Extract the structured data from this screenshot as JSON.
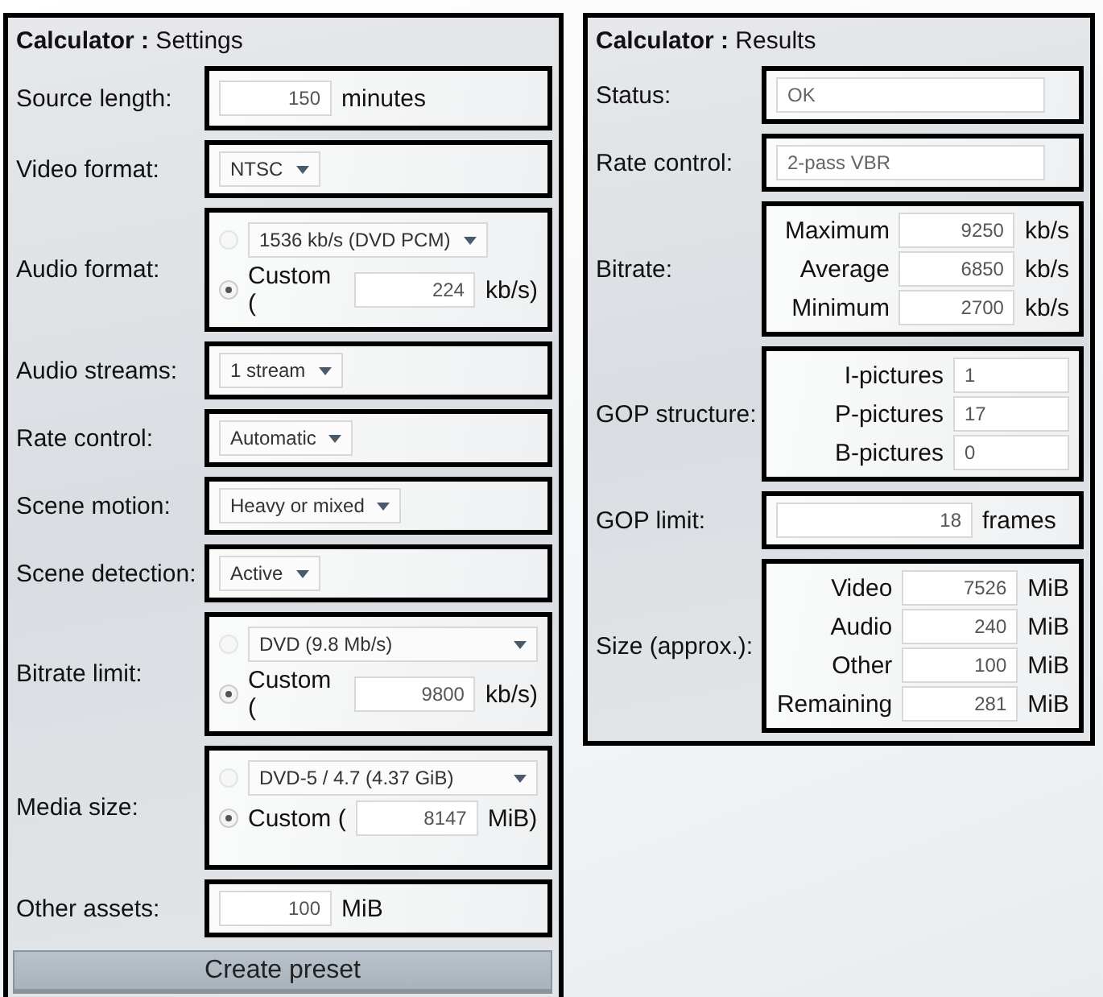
{
  "settings": {
    "title": "**Calculator :** Settings",
    "rows": [
      {
        "kind": "input",
        "label": "Source length:",
        "value": "150",
        "unit": "minutes"
      },
      {
        "kind": "select",
        "label": "Video format:",
        "value": "NTSC"
      },
      {
        "kind": "radio",
        "label": "Audio format:",
        "options": [
          {
            "kind": "select",
            "value": "1536 kb/s (DVD PCM)",
            "selected": false
          },
          {
            "kind": "custom",
            "text": "Custom (",
            "value": "224",
            "unit": "kb/s)",
            "selected": true
          }
        ]
      },
      {
        "kind": "select",
        "label": "Audio streams:",
        "value": "1 stream"
      },
      {
        "kind": "select",
        "label": "Rate control:",
        "value": "Automatic"
      },
      {
        "kind": "select",
        "label": "Scene motion:",
        "value": "Heavy or mixed"
      },
      {
        "kind": "select",
        "label": "Scene detection:",
        "value": "Active"
      },
      {
        "kind": "radio",
        "label": "Bitrate limit:",
        "options": [
          {
            "kind": "select",
            "value": "DVD (9.8 Mb/s)",
            "selected": false
          },
          {
            "kind": "custom",
            "text": "Custom (",
            "value": "9800",
            "unit": "kb/s)",
            "selected": true
          }
        ]
      },
      {
        "kind": "radio",
        "label": "Media size:",
        "options": [
          {
            "kind": "select",
            "value": "DVD-5 / 4.7 (4.37 GiB)",
            "selected": false
          },
          {
            "kind": "custom",
            "text": "Custom (",
            "value": "8147",
            "unit": "MiB)",
            "selected": true
          }
        ]
      },
      {
        "kind": "input",
        "label": "Other assets:",
        "value": "100",
        "unit": "MiB"
      }
    ],
    "button": "Create preset"
  },
  "results": {
    "title": "**Calculator :** Results",
    "rows": [
      {
        "kind": "display",
        "label": "Status:",
        "value": "OK"
      },
      {
        "kind": "display",
        "label": "Rate control:",
        "value": "2-pass VBR"
      },
      {
        "kind": "fields",
        "label": "Bitrate:",
        "items": [
          {
            "label": "Maximum",
            "value": "9250",
            "unit": "kb/s"
          },
          {
            "label": "Average",
            "value": "6850",
            "unit": "kb/s"
          },
          {
            "label": "Minimum",
            "value": "2700",
            "unit": "kb/s"
          }
        ]
      },
      {
        "kind": "fields",
        "label": "GOP structure:",
        "items": [
          {
            "label": "I-pictures",
            "value": "1"
          },
          {
            "label": "P-pictures",
            "value": "17"
          },
          {
            "label": "B-pictures",
            "value": "0"
          }
        ]
      },
      {
        "kind": "input",
        "label": "GOP limit:",
        "value": "18",
        "unit": "frames"
      },
      {
        "kind": "fields",
        "label": "Size (approx.):",
        "items": [
          {
            "label": "Video",
            "value": "7526",
            "unit": "MiB"
          },
          {
            "label": "Audio",
            "value": "240",
            "unit": "MiB"
          },
          {
            "label": "Other",
            "value": "100",
            "unit": "MiB"
          },
          {
            "label": "Remaining",
            "value": "281",
            "unit": "MiB"
          }
        ]
      }
    ]
  }
}
